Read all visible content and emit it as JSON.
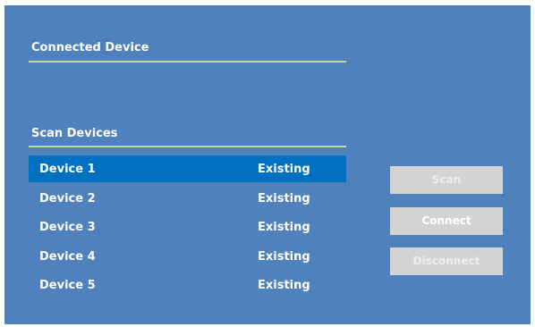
{
  "connected_section": {
    "title": "Connected Device"
  },
  "scan_section": {
    "title": "Scan Devices",
    "devices": [
      {
        "name": "Device 1",
        "status": "Existing",
        "selected": true
      },
      {
        "name": "Device 2",
        "status": "Existing",
        "selected": false
      },
      {
        "name": "Device 3",
        "status": "Existing",
        "selected": false
      },
      {
        "name": "Device 4",
        "status": "Existing",
        "selected": false
      },
      {
        "name": "Device 5",
        "status": "Existing",
        "selected": false
      }
    ]
  },
  "buttons": {
    "scan_label": "Scan",
    "connect_label": "Connect",
    "disconnect_label": "Disconnect"
  },
  "colors": {
    "panel_background": "#4f81bd",
    "selected_row": "#0070c0",
    "divider": "#c3d69b",
    "button_background": "#d3d3d3"
  }
}
